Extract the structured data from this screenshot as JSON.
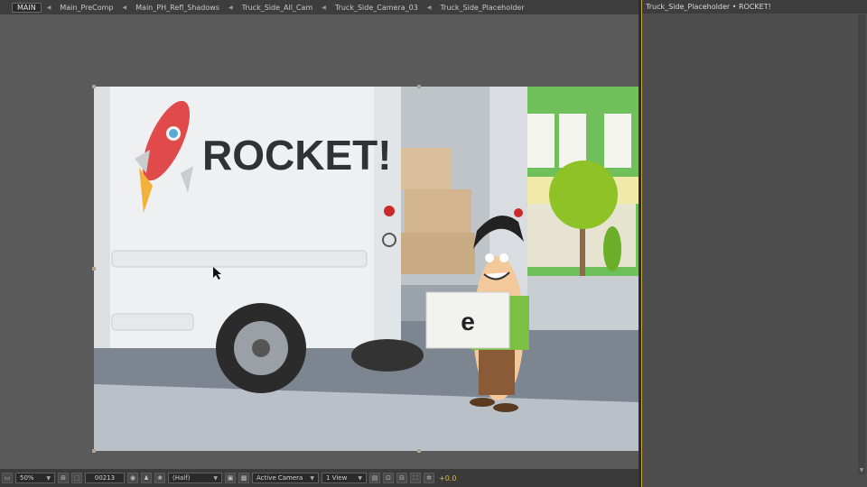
{
  "breadcrumb": {
    "items": [
      "MAIN",
      "Main_PreComp",
      "Main_PH_Refl_Shadows",
      "Truck_Side_All_Cam",
      "Truck_Side_Camera_03",
      "Truck_Side_Placeholder"
    ]
  },
  "right_panel": {
    "title": "Truck_Side_Placeholder • ROCKET!"
  },
  "scene": {
    "truck_logo_text": "ROCKET!",
    "box_letter": "e"
  },
  "toolbar": {
    "zoom": "50%",
    "timecode": "00213",
    "resolution": "(Half)",
    "camera": "Active Camera",
    "view": "1 View",
    "exposure": "+0.0"
  },
  "colors": {
    "accent": "#c9a447",
    "exposure": "#d9b74a",
    "rocket_red": "#e14a4a",
    "wall_green": "#6fbf5a"
  }
}
